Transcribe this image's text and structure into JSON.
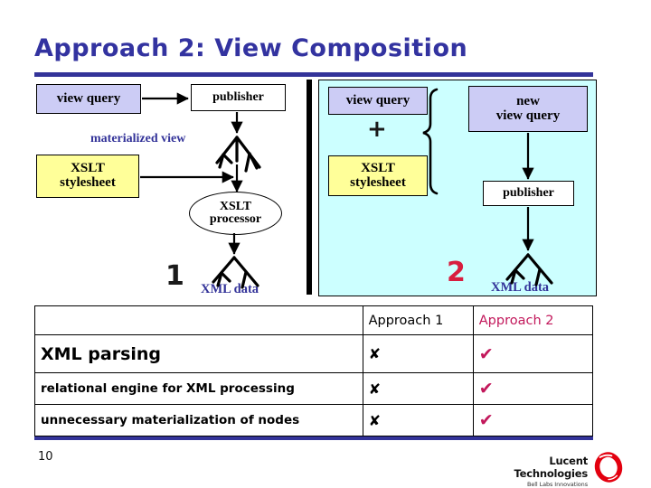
{
  "slide": {
    "title": "Approach 2: View Composition",
    "page_number": "10",
    "title_color": "#3333a0",
    "rule_color": "#333399"
  },
  "approach1": {
    "number": "1",
    "number_color": "#1a1a1a",
    "view_query": "view query",
    "publisher": "publisher",
    "materialized_view": "materialized view",
    "xslt_stylesheet_line1": "XSLT",
    "xslt_stylesheet_line2": "stylesheet",
    "xslt_processor_line1": "XSLT",
    "xslt_processor_line2": "processor",
    "xml_data": "XML data",
    "box_colors": {
      "view_query": "#ccccf5",
      "publisher": "#ffffff",
      "xslt_stylesheet": "#ffff99"
    }
  },
  "approach2": {
    "number": "2",
    "number_color": "#d81d3f",
    "panel_background": "#ccffff",
    "view_query": "view query",
    "plus": "+",
    "xslt_stylesheet_line1": "XSLT",
    "xslt_stylesheet_line2": "stylesheet",
    "new_view_query_line1": "new",
    "new_view_query_line2": "view query",
    "publisher": "publisher",
    "xml_data": "XML data",
    "box_colors": {
      "view_query": "#ccccf5",
      "xslt_stylesheet": "#ffff99",
      "new_view_query": "#ccccf5",
      "publisher": "#ffffff"
    }
  },
  "comparison": {
    "columns": [
      "",
      "Approach 1",
      "Approach 2"
    ],
    "column_colors": [
      "#000000",
      "#000000",
      "#c2185b"
    ],
    "rows": [
      {
        "feature": "XML parsing",
        "approach1": "✘",
        "approach2": "✔"
      },
      {
        "feature": "relational engine for XML processing",
        "approach1": "✘",
        "approach2": "✔"
      },
      {
        "feature": "unnecessary materialization of nodes",
        "approach1": "✘",
        "approach2": "✔"
      }
    ]
  },
  "footer": {
    "logo_name": "Lucent Technologies",
    "logo_tagline": "Bell Labs Innovations",
    "logo_color": "#e3000f"
  }
}
